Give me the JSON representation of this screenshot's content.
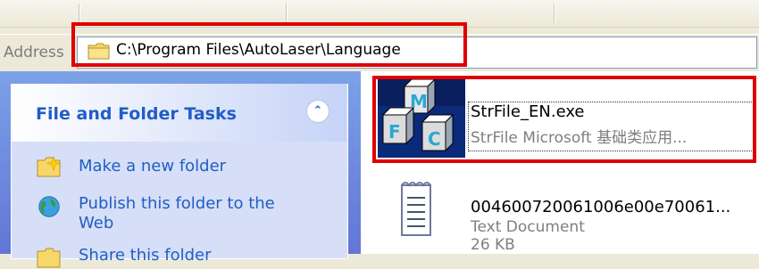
{
  "address_bar": {
    "label": "Address",
    "path": "C:\\Program Files\\AutoLaser\\Language"
  },
  "task_pane": {
    "title": "File and Folder Tasks",
    "items": [
      {
        "label": "Make a new folder",
        "icon": "new-folder-icon"
      },
      {
        "label": "Publish this folder to the Web",
        "icon": "publish-web-icon"
      },
      {
        "label": "Share this folder",
        "icon": "share-folder-icon"
      }
    ]
  },
  "files": [
    {
      "name": "StrFile_EN.exe",
      "description": "StrFile Microsoft 基础类应用...",
      "icon": "mfc-app-icon"
    },
    {
      "name": "004600720061006e00e70061...",
      "type": "Text Document",
      "size": "26 KB",
      "icon": "text-document-icon"
    }
  ],
  "colors": {
    "highlight": "#e00000",
    "task_link": "#215dc6"
  }
}
